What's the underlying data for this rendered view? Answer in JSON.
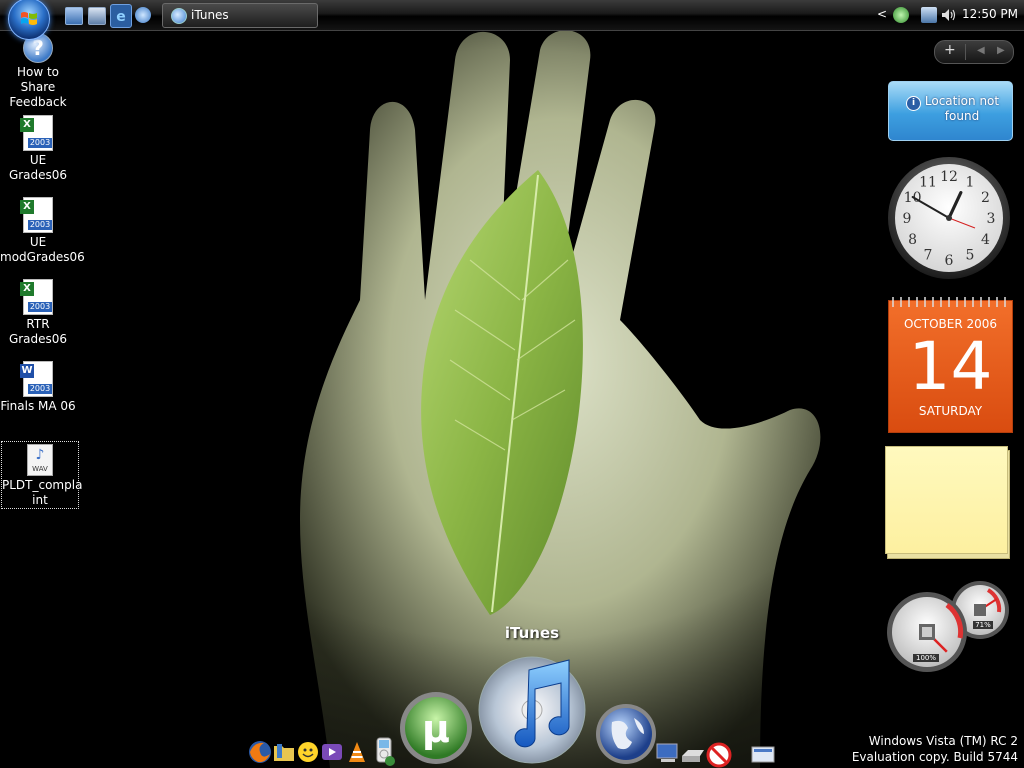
{
  "taskbar": {
    "active_window": "iTunes",
    "clock": "12:50 PM",
    "tray_arrow": "<",
    "quick_launch": [
      "show-desktop-icon",
      "switch-windows-icon",
      "ie-icon",
      "itunes-icon"
    ]
  },
  "desktop_icons": [
    {
      "label": "How to Share Feedback",
      "icon": "help-icon"
    },
    {
      "label": "UE Grades06",
      "icon": "excel-icon",
      "badge": "X",
      "year": "2003"
    },
    {
      "label": "UE modGrades06",
      "icon": "excel-icon",
      "badge": "X",
      "year": "2003"
    },
    {
      "label": "RTR Grades06",
      "icon": "excel-icon",
      "badge": "X",
      "year": "2003"
    },
    {
      "label": "Finals MA 06",
      "icon": "word-icon",
      "badge": "W",
      "year": "2003"
    },
    {
      "label": "PLDT_complaint",
      "label_line1": "PLDT_compla",
      "label_line2": "int",
      "icon": "wav-icon",
      "type_tag": "WAV"
    }
  ],
  "gadgets": {
    "control_plus": "+",
    "control_prev": "◀",
    "control_next": "▶",
    "weather": {
      "message": "Location not found",
      "info_glyph": "i"
    },
    "clock": {
      "numerals": [
        "12",
        "1",
        "2",
        "3",
        "4",
        "5",
        "6",
        "7",
        "8",
        "9",
        "10",
        "11"
      ],
      "hour": 12,
      "minute": 50
    },
    "calendar": {
      "month_year": "OCTOBER 2006",
      "day": "14",
      "weekday": "SATURDAY"
    },
    "cpu_meter": {
      "cpu_percent": 100,
      "cpu_label": "100%",
      "memory_percent": 71,
      "memory_label": "71%"
    }
  },
  "dock": {
    "hover_label": "iTunes",
    "icons": [
      "firefox-icon",
      "folder-icon",
      "messenger-icon",
      "vlc-icon",
      "ipod-icon",
      "utorrent-icon",
      "itunes-icon",
      "globe-icon",
      "computer-icon",
      "drive-icon",
      "blocked-icon",
      "monitor-icon"
    ]
  },
  "watermark": {
    "line1": "Windows Vista (TM) RC 2",
    "line2": "Evaluation copy. Build 5744"
  },
  "colors": {
    "calendar": "#e85a1a",
    "weather": "#3d9fe0",
    "note": "#fff7b3",
    "taskbar": "#1a1a1a"
  }
}
